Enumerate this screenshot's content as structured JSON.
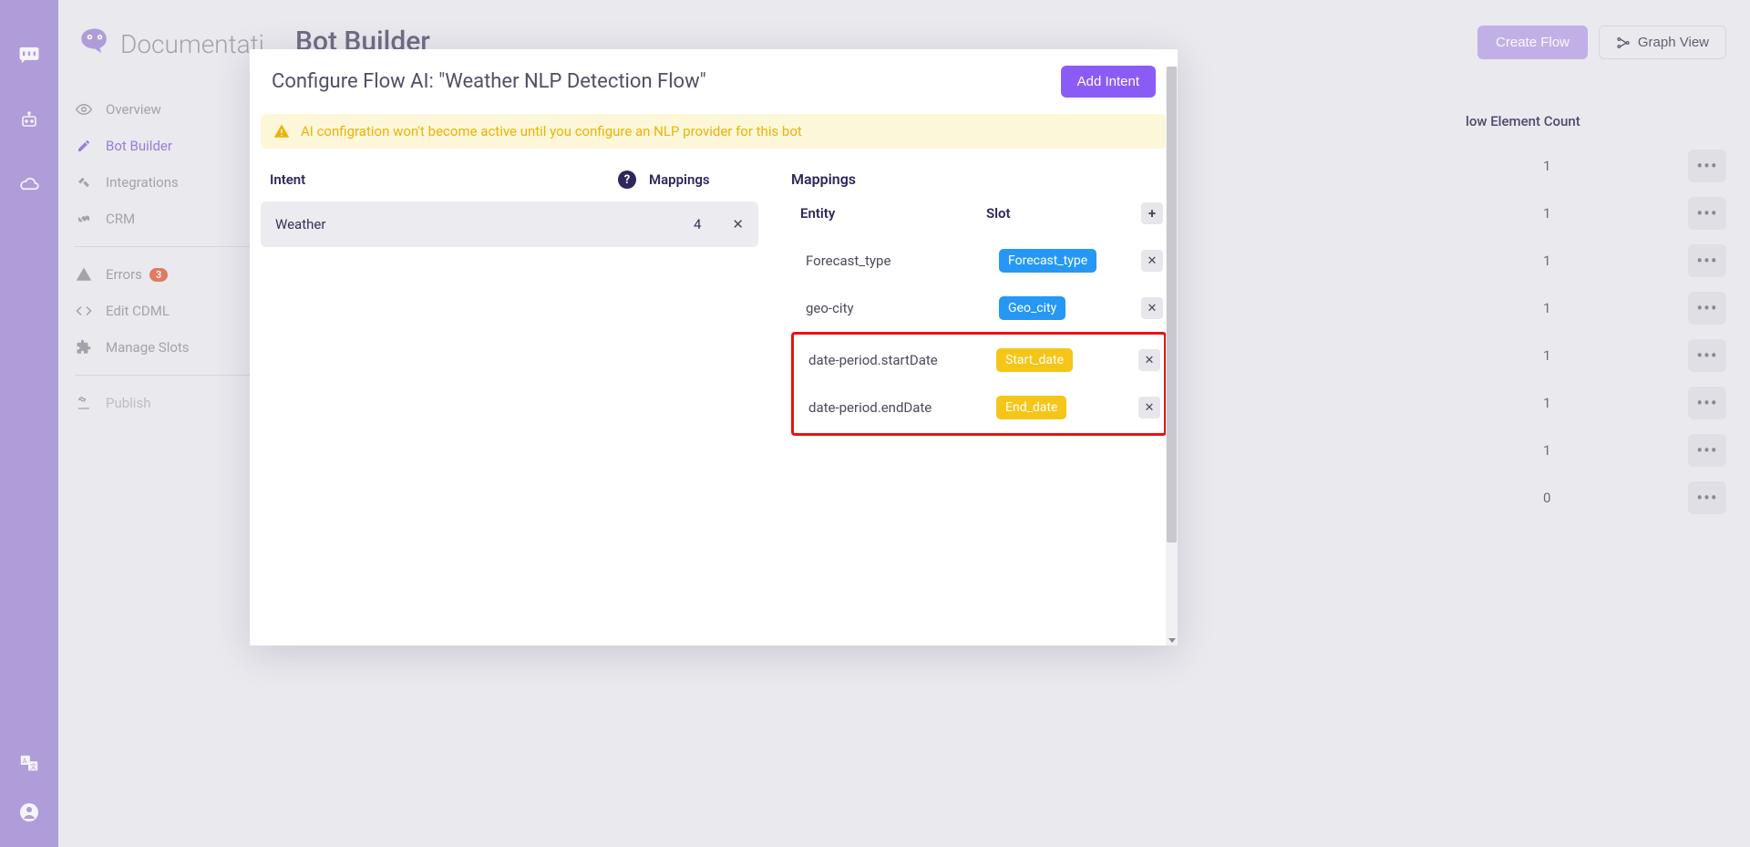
{
  "rail": {
    "items": [
      "chat-icon",
      "bot-icon",
      "cloud-icon"
    ],
    "bottom": [
      "translate-icon",
      "user-icon"
    ]
  },
  "sidebar": {
    "brand_text": "Documentati",
    "nav": [
      {
        "icon": "eye-icon",
        "label": "Overview"
      },
      {
        "icon": "pencil-icon",
        "label": "Bot Builder"
      },
      {
        "icon": "integrations-icon",
        "label": "Integrations"
      },
      {
        "icon": "handshake-icon",
        "label": "CRM"
      }
    ],
    "nav2": [
      {
        "icon": "warning-icon",
        "label": "Errors",
        "badge": "3"
      },
      {
        "icon": "code-icon",
        "label": "Edit CDML"
      },
      {
        "icon": "puzzle-icon",
        "label": "Manage Slots"
      }
    ],
    "nav3": [
      {
        "icon": "publish-icon",
        "label": "Publish"
      }
    ]
  },
  "page": {
    "title": "Bot Builder",
    "create_flow": "Create Flow",
    "graph_view": "Graph View",
    "table": {
      "header_count": "low Element Count",
      "rows": [
        {
          "count": "1"
        },
        {
          "count": "1"
        },
        {
          "count": "1"
        },
        {
          "count": "1"
        },
        {
          "count": "1"
        },
        {
          "count": "1"
        },
        {
          "count": "1"
        },
        {
          "count": "0"
        }
      ]
    }
  },
  "modal": {
    "title": "Configure Flow AI: \"Weather NLP Detection Flow\"",
    "add_intent": "Add Intent",
    "warning": "AI configration won't become active until you configure an NLP provider for this bot",
    "left": {
      "intent_header": "Intent",
      "mappings_header": "Mappings",
      "intent": {
        "name": "Weather",
        "count": "4"
      }
    },
    "right": {
      "header": "Mappings",
      "entity_header": "Entity",
      "slot_header": "Slot",
      "rows": [
        {
          "entity": "Forecast_type",
          "slot": "Forecast_type",
          "color": "blue"
        },
        {
          "entity": "geo-city",
          "slot": "Geo_city",
          "color": "blue"
        },
        {
          "entity": "date-period.startDate",
          "slot": "Start_date",
          "color": "yellow"
        },
        {
          "entity": "date-period.endDate",
          "slot": "End_date",
          "color": "yellow"
        }
      ]
    }
  }
}
